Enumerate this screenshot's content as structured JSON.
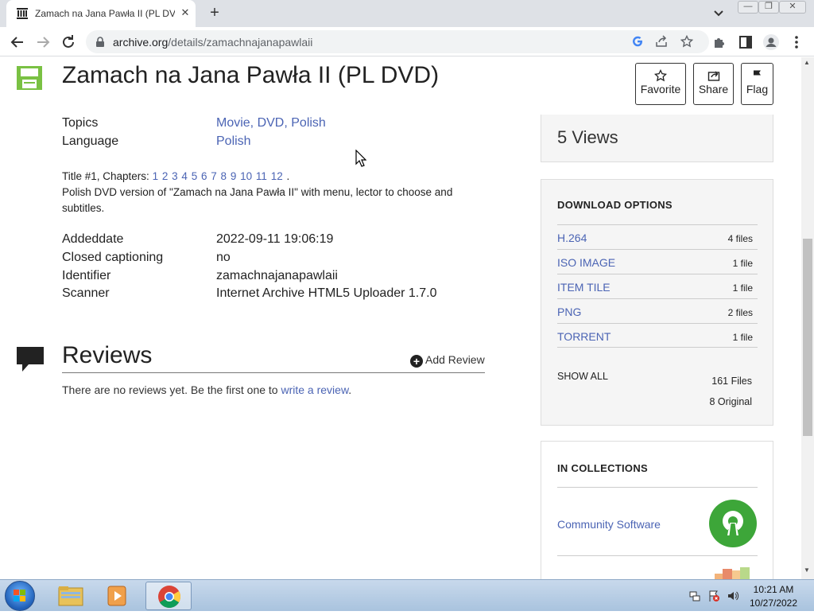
{
  "browser": {
    "tab_title": "Zamach na Jana Pawła II (PL DVD",
    "new_tab_label": "+",
    "url_host": "archive.org",
    "url_path": "/details/zamachnajanapawlaii"
  },
  "item": {
    "title": "Zamach na Jana Pawła II (PL DVD)",
    "actions": [
      {
        "label": "Favorite",
        "icon": "star-icon"
      },
      {
        "label": "Share",
        "icon": "share-icon"
      },
      {
        "label": "Flag",
        "icon": "flag-icon"
      }
    ],
    "topics_label": "Topics",
    "topics_value": "Movie, DVD, Polish",
    "language_label": "Language",
    "language_value": "Polish",
    "chapters_prefix": "Title #1, Chapters:",
    "chapters": [
      "1",
      "2",
      "3",
      "4",
      "5",
      "6",
      "7",
      "8",
      "9",
      "10",
      "11",
      "12"
    ],
    "chapters_suffix": ".",
    "description": "Polish DVD version of \"Zamach na Jana Pawła II\" with menu, lector to choose and subtitles.",
    "metadata": [
      {
        "key": "Addeddate",
        "value": "2022-09-11 19:06:19"
      },
      {
        "key": "Closed captioning",
        "value": "no"
      },
      {
        "key": "Identifier",
        "value": "zamachnajanapawlaii"
      },
      {
        "key": "Scanner",
        "value": "Internet Archive HTML5 Uploader 1.7.0"
      }
    ]
  },
  "reviews": {
    "title": "Reviews",
    "add_label": "Add Review",
    "empty_text": "There are no reviews yet. Be the first one to",
    "write_link": "write a review",
    "empty_suffix": "."
  },
  "sidebar": {
    "views": "5 Views",
    "download_heading": "DOWNLOAD OPTIONS",
    "downloads": [
      {
        "format": "H.264",
        "count": "4 files"
      },
      {
        "format": "ISO IMAGE",
        "count": "1 file"
      },
      {
        "format": "ITEM TILE",
        "count": "1 file"
      },
      {
        "format": "PNG",
        "count": "2 files"
      },
      {
        "format": "TORRENT",
        "count": "1 file"
      }
    ],
    "show_all": "SHOW ALL",
    "total_files": "161 Files",
    "original_files": "8 Original",
    "collections_heading": "IN COLLECTIONS",
    "collections": [
      {
        "name": "Community Software"
      }
    ]
  },
  "taskbar": {
    "time": "10:21 AM",
    "date": "10/27/2022"
  },
  "colors": {
    "link": "#4b64b4",
    "floppy_green": "#7ac143",
    "osi_green": "#3da639"
  }
}
